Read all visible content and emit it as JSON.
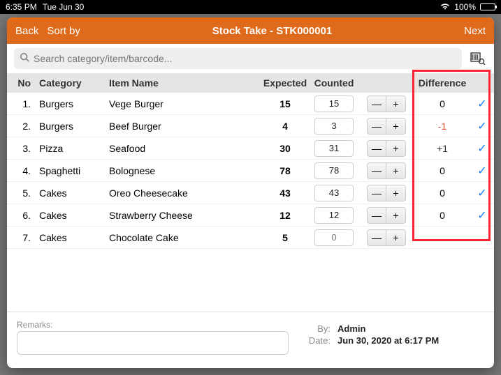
{
  "statusbar": {
    "time": "6:35 PM",
    "date": "Tue Jun 30",
    "battery": "100%"
  },
  "nav": {
    "back": "Back",
    "sort": "Sort by",
    "title": "Stock Take - STK000001",
    "next": "Next"
  },
  "search": {
    "placeholder": "Search category/item/barcode..."
  },
  "columns": {
    "no": "No",
    "category": "Category",
    "item": "Item Name",
    "expected": "Expected",
    "counted": "Counted",
    "difference": "Difference"
  },
  "rows": [
    {
      "no": "1.",
      "category": "Burgers",
      "item": "Vege Burger",
      "expected": "15",
      "counted": "15",
      "diff": "0",
      "diffClass": "",
      "checked": true
    },
    {
      "no": "2.",
      "category": "Burgers",
      "item": "Beef Burger",
      "expected": "4",
      "counted": "3",
      "diff": "-1",
      "diffClass": "neg",
      "checked": true
    },
    {
      "no": "3.",
      "category": "Pizza",
      "item": "Seafood",
      "expected": "30",
      "counted": "31",
      "diff": "+1",
      "diffClass": "pos",
      "checked": true
    },
    {
      "no": "4.",
      "category": "Spaghetti",
      "item": "Bolognese",
      "expected": "78",
      "counted": "78",
      "diff": "0",
      "diffClass": "",
      "checked": true
    },
    {
      "no": "5.",
      "category": "Cakes",
      "item": "Oreo Cheesecake",
      "expected": "43",
      "counted": "43",
      "diff": "0",
      "diffClass": "",
      "checked": true
    },
    {
      "no": "6.",
      "category": "Cakes",
      "item": "Strawberry Cheese",
      "expected": "12",
      "counted": "12",
      "diff": "0",
      "diffClass": "",
      "checked": true
    },
    {
      "no": "7.",
      "category": "Cakes",
      "item": "Chocolate Cake",
      "expected": "5",
      "counted": "",
      "diff": "",
      "diffClass": "",
      "checked": false
    }
  ],
  "remarks": {
    "label": "Remarks:",
    "value": ""
  },
  "meta": {
    "byLabel": "By:",
    "byValue": "Admin",
    "dateLabel": "Date:",
    "dateValue": "Jun 30, 2020 at 6:17 PM"
  },
  "stepper": {
    "minus": "—",
    "plus": "+"
  },
  "uncountedPlaceholder": "0"
}
